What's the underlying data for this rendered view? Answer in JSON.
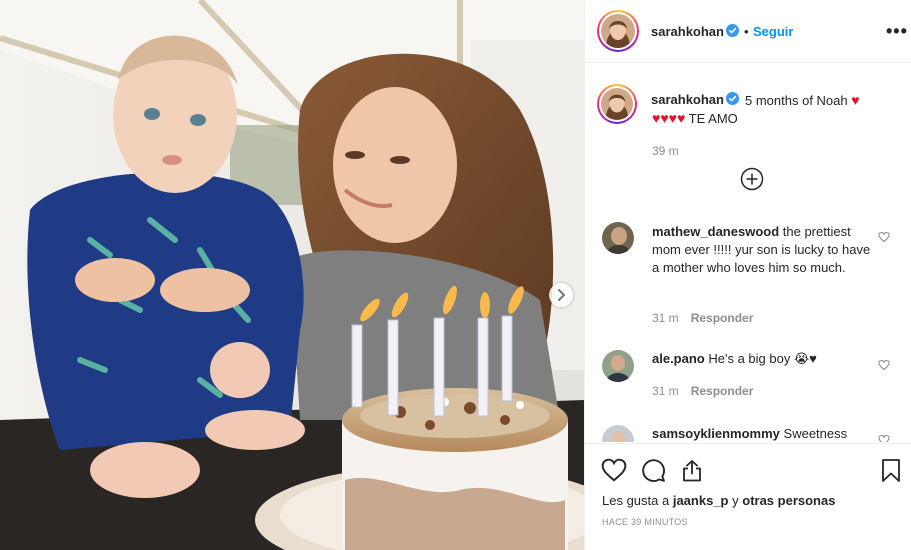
{
  "post": {
    "username": "sarahkohan",
    "separator": "•",
    "follow_label": "Seguir",
    "more_label": "•••"
  },
  "caption": {
    "username": "sarahkohan",
    "text_line1": "5 months of Noah",
    "hearts_line2": "♥♥♥♥",
    "text_line2": "TE AMO",
    "heart_glyph": "♥",
    "time": "39 m"
  },
  "comments": [
    {
      "username": "mathew_daneswood",
      "text": "the prettiest mom ever !!!!! yur son is lucky to have a mother who loves him so much.",
      "time": "31 m",
      "reply_label": "Responder"
    },
    {
      "username": "ale.pano",
      "text": "He's a big boy",
      "emoji": "😭♥",
      "time": "31 m",
      "reply_label": "Responder"
    },
    {
      "username": "samsoyklienmommy",
      "text": "Sweetness"
    }
  ],
  "footer": {
    "likes_prefix": "Les gusta a",
    "likes_user": "jaanks_p",
    "likes_suffix": "y",
    "likes_others": "otras personas",
    "time_ago": "Hace 39 minutos"
  },
  "colors": {
    "accent_blue": "#0095f6",
    "verified_blue": "#3897f0",
    "heart_red": "#e0142c",
    "muted_gray": "#8e8e8e"
  },
  "icons": [
    "verified-badge-icon",
    "more-options-icon",
    "load-more-comments-icon",
    "like-comment-icon",
    "like-post-icon",
    "comment-icon",
    "share-icon",
    "save-icon",
    "carousel-next-icon"
  ]
}
